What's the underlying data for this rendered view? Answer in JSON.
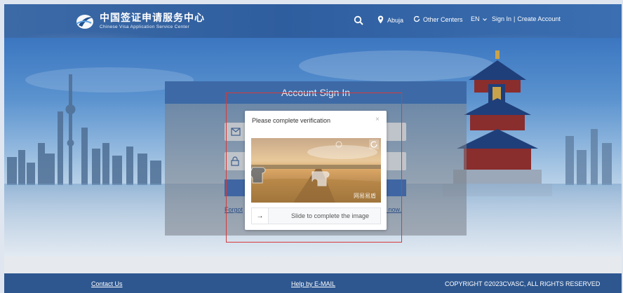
{
  "header": {
    "logo_cn": "中国签证申请服务中心",
    "logo_en": "Chinese Visa Application Service Center",
    "location": "Abuja",
    "other_centers": "Other Centers",
    "language": "EN",
    "sign_in": "Sign In",
    "separator": "|",
    "create_account": "Create Account"
  },
  "signin": {
    "title": "Account Sign In",
    "forgot_fragment": "Forgot",
    "signup_fragment": "e now."
  },
  "captcha": {
    "title": "Please complete verification",
    "close": "×",
    "slider_text": "Slide to complete the image",
    "watermark": "网易易盾",
    "arrow": "→"
  },
  "footer": {
    "contact": "Contact Us",
    "help": "Help by E-MAIL",
    "copyright": "COPYRIGHT ©2023CVASC, ALL RIGHTS RESERVED"
  },
  "icons": [
    "logo-icon",
    "search-icon",
    "location-pin-icon",
    "refresh-icon",
    "chevron-down-icon",
    "mail-icon",
    "lock-icon",
    "refresh-captcha-icon",
    "arrow-right-icon"
  ],
  "colors": {
    "header": "#2f5e9f",
    "footer": "#2e5790",
    "highlight": "#d63a3a",
    "button": "#3f66a3"
  }
}
